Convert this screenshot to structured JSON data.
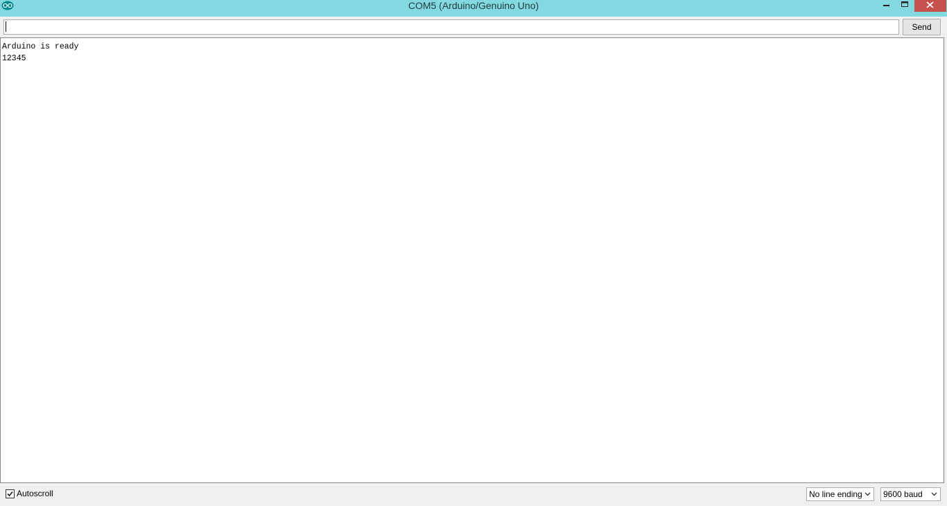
{
  "window": {
    "title": "COM5 (Arduino/Genuino Uno)",
    "accent_color": "#84d8e0",
    "close_color": "#c7504d",
    "icons": {
      "app": "arduino-logo-icon",
      "minimize": "minimize-icon",
      "maximize": "maximize-icon",
      "close": "close-icon"
    }
  },
  "send_bar": {
    "input_value": "",
    "send_label": "Send"
  },
  "serial_output": {
    "lines": [
      "Arduino is ready",
      "12345"
    ]
  },
  "footer": {
    "autoscroll_label": "Autoscroll",
    "autoscroll_checked": true,
    "line_ending": "No line ending",
    "baud_rate": "9600 baud"
  }
}
